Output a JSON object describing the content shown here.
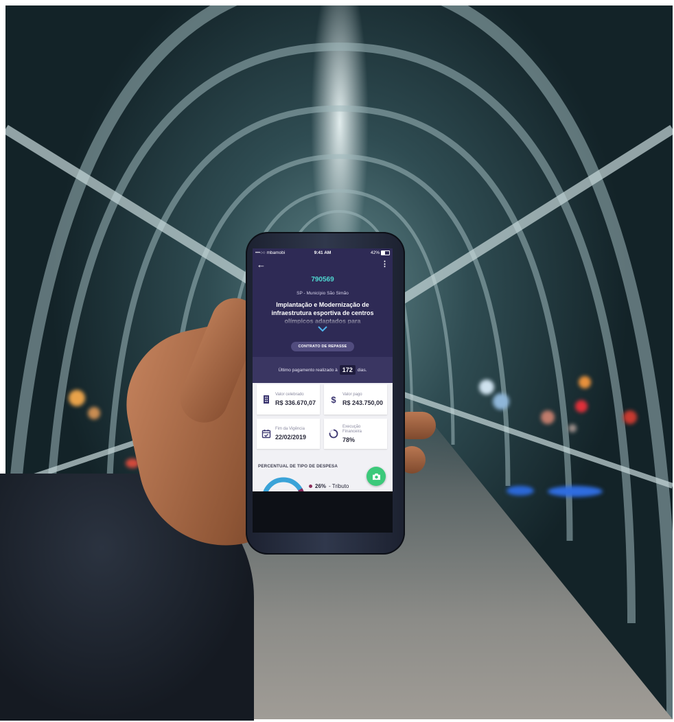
{
  "status_bar": {
    "carrier": "•••○○ mbamobi",
    "time": "9:41 AM",
    "battery": "42%"
  },
  "header": {
    "code": "790569",
    "municipio": "SP - Município São Simão",
    "title": "Implantação e Modernização de infraestrutura esportiva de centros olímpicos adaptados para treinamento",
    "contract_button": "CONTRATO DE REPASSE"
  },
  "payment": {
    "prefix": "Último pagamento realizado à",
    "days": "172",
    "suffix": "dias."
  },
  "cards": {
    "valor_celebrado": {
      "label": "Valor celebrado",
      "value": "R$ 336.670,07",
      "icon": "building-icon"
    },
    "valor_pago": {
      "label": "Valor pago",
      "value": "R$ 243.750,00",
      "icon": "dollar-icon"
    },
    "fim_vigencia": {
      "label": "Fim da Vigência",
      "value": "22/02/2019",
      "icon": "calendar-check-icon"
    },
    "execucao": {
      "label_line1": "Execução",
      "label_line2": "Financeira",
      "value": "78%",
      "progress": 0.78,
      "icon": "progress-ring-icon"
    }
  },
  "expense": {
    "section_title": "PERCENTUAL DE TIPO DE DESPESA",
    "legend_pct": "26%",
    "legend_label": "- Tributo"
  },
  "colors": {
    "header_bg": "#2e2a55",
    "accent_teal": "#4fd8d0",
    "fab_green": "#3cc97a",
    "icon_purple": "#3b3670"
  }
}
